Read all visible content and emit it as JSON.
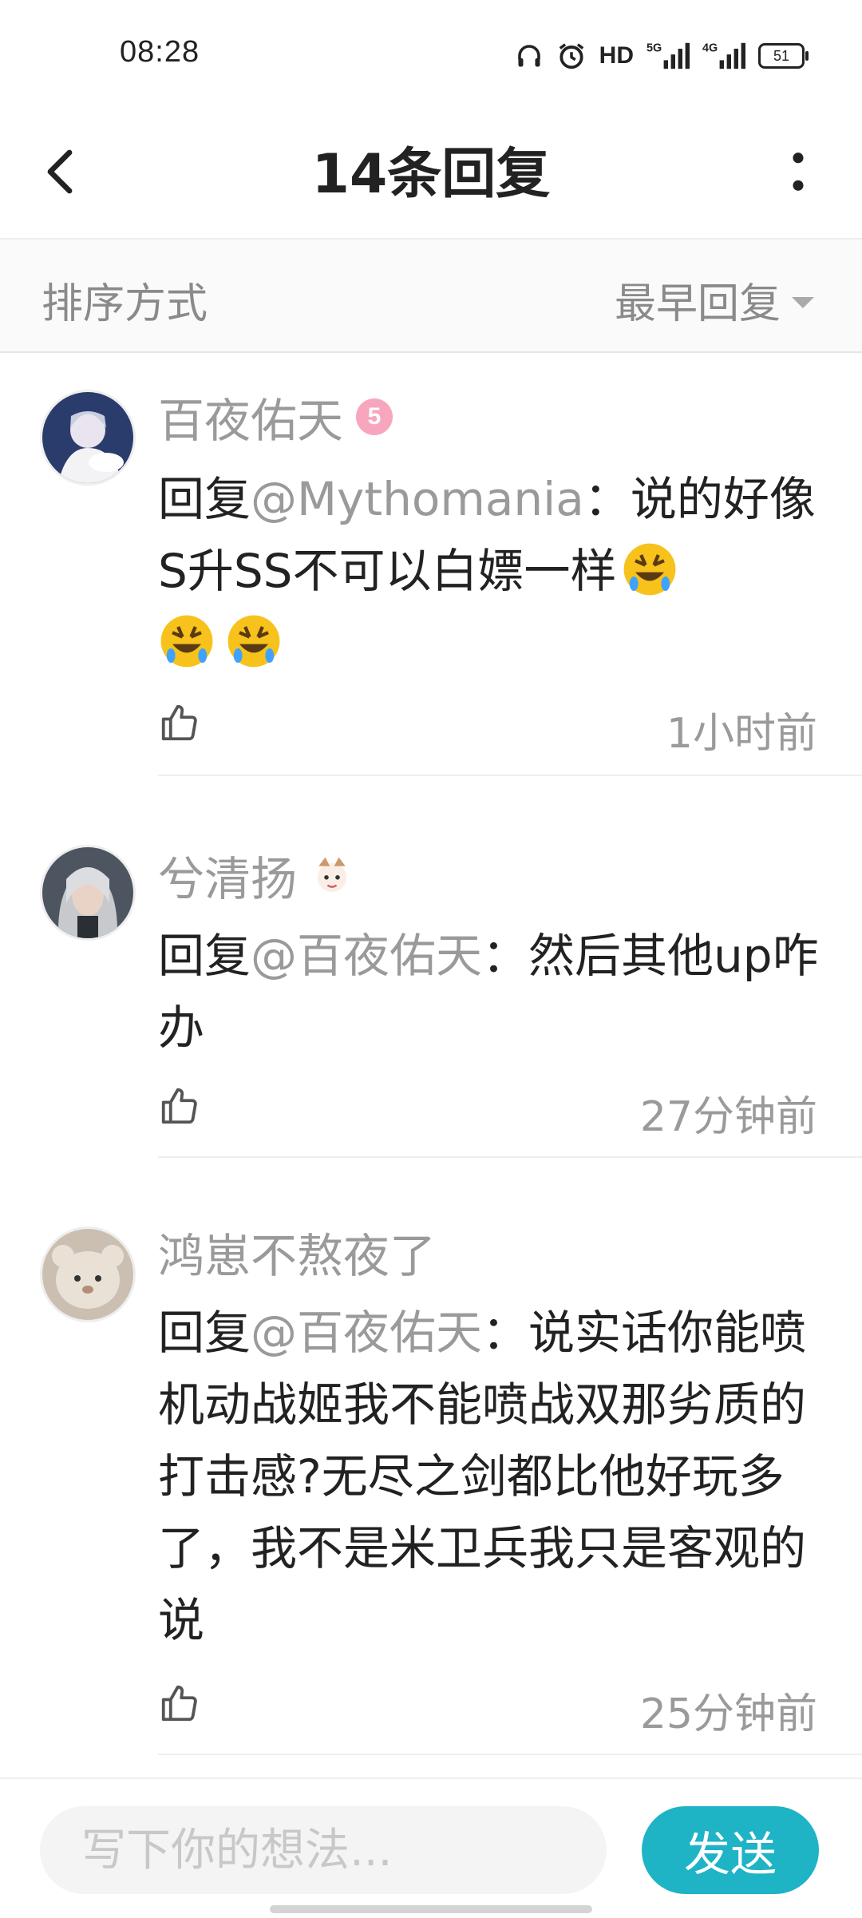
{
  "status_bar": {
    "time": "08:28",
    "hd_label": "HD",
    "battery": "51"
  },
  "header": {
    "title": "14条回复"
  },
  "sort": {
    "label": "排序方式",
    "selected": "最早回复"
  },
  "replies": [
    {
      "username": "百夜佑天",
      "level": "5",
      "reply_prefix": "回复",
      "mention": "@Mythomania",
      "text": "：说的好像S升SS不可以白嫖一样",
      "emoji": "rofl-emoji",
      "time": "1小时前"
    },
    {
      "username": "兮清扬",
      "reply_prefix": "回复",
      "mention": "@百夜佑天",
      "text": "：然后其他up咋办",
      "time": "27分钟前"
    },
    {
      "username": "鸿崽不熬夜了",
      "reply_prefix": "回复",
      "mention": "@百夜佑天",
      "text": "：说实话你能喷机动战姬我不能喷战双那劣质的打击感?无尽之剑都比他好玩多了，我不是米卫兵我只是客观的说",
      "time": "25分钟前"
    }
  ],
  "composer": {
    "placeholder": "写下你的想法...",
    "send_label": "发送"
  },
  "colors": {
    "accent": "#1fb3c6",
    "muted_text": "#9a9a9a",
    "level_badge": "#f7a6bd"
  }
}
